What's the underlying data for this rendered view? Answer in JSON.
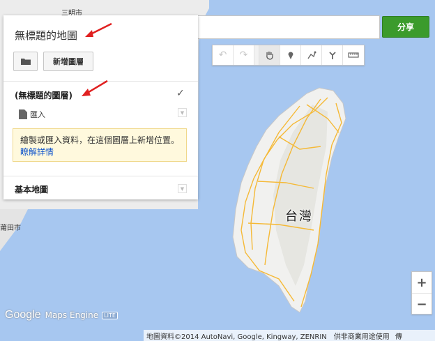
{
  "map": {
    "city_labels": [
      "三明市",
      "莆田市"
    ],
    "island_label": "台灣",
    "colors": {
      "water": "#a7c7f0",
      "land": "#ececec",
      "roads": "#f5b936"
    }
  },
  "search": {
    "value": ""
  },
  "share_button": {
    "label": "分享",
    "color": "#3b9b2c"
  },
  "toolbar": {
    "buttons": [
      {
        "icon": "undo-icon",
        "state": "disabled"
      },
      {
        "icon": "redo-icon",
        "state": "disabled"
      },
      {
        "icon": "hand-pan-icon",
        "state": "active"
      },
      {
        "icon": "marker-icon",
        "state": "normal"
      },
      {
        "icon": "draw-line-icon",
        "state": "normal"
      },
      {
        "icon": "directions-icon",
        "state": "normal"
      },
      {
        "icon": "ruler-icon",
        "state": "normal"
      }
    ]
  },
  "panel": {
    "map_title": "無標題的地圖",
    "new_layer_label": "新增圖層",
    "layer": {
      "title": "(無標題的圖層)",
      "checked": true,
      "import_label": "匯入",
      "info_text": "繪製或匯入資料，在這個圖層上新增位置。",
      "info_link": "瞭解詳情"
    },
    "base_map_title": "基本地圖"
  },
  "zoom": {
    "in_label": "+",
    "out_label": "−"
  },
  "branding": {
    "google": "Google",
    "product": "Maps Engine",
    "badge": "LITE"
  },
  "footer": {
    "attribution": "地圖資料©2014 AutoNavi, Google, Kingway, ZENRIN",
    "terms": "供非商業用途使用",
    "report": "傳"
  }
}
